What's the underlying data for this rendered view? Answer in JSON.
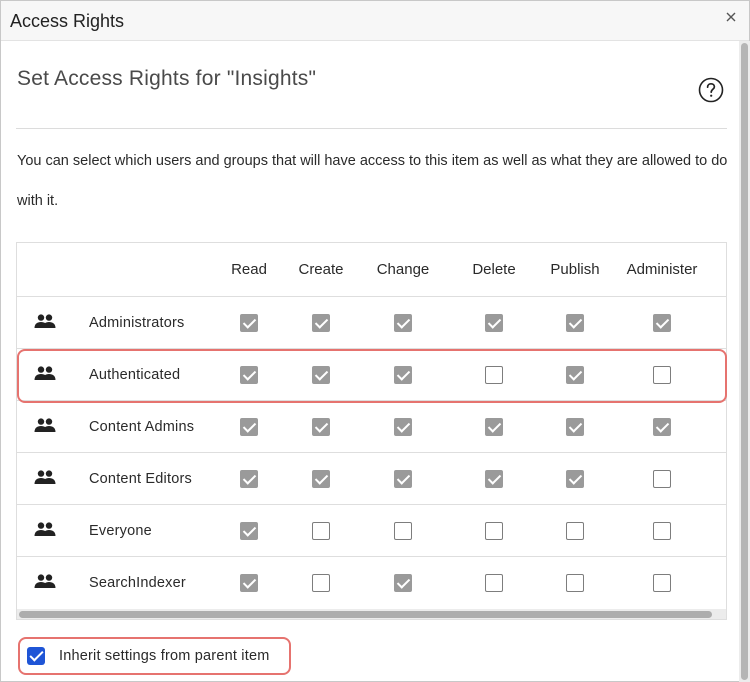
{
  "dialog": {
    "title": "Access Rights",
    "heading": "Set Access Rights for \"Insights\"",
    "description": "You can select which users and groups that will have access to this item as well as what they are allowed to do with it."
  },
  "table": {
    "columns": [
      "Read",
      "Create",
      "Change",
      "Delete",
      "Publish",
      "Administer"
    ],
    "rows": [
      {
        "name": "Administrators",
        "values": [
          true,
          true,
          true,
          true,
          true,
          true
        ]
      },
      {
        "name": "Authenticated",
        "values": [
          true,
          true,
          true,
          false,
          true,
          false
        ]
      },
      {
        "name": "Content Admins",
        "values": [
          true,
          true,
          true,
          true,
          true,
          true
        ]
      },
      {
        "name": "Content Editors",
        "values": [
          true,
          true,
          true,
          true,
          true,
          false
        ]
      },
      {
        "name": "Everyone",
        "values": [
          true,
          false,
          false,
          false,
          false,
          false
        ]
      },
      {
        "name": "SearchIndexer",
        "values": [
          true,
          false,
          true,
          false,
          false,
          false
        ]
      }
    ]
  },
  "inherit": {
    "label": "Inherit settings from parent item",
    "checked": true
  },
  "colors": {
    "highlight": "#e6736f",
    "checkbox_checked": "#1f55d6",
    "disabled_checked": "#9a9a9a"
  }
}
